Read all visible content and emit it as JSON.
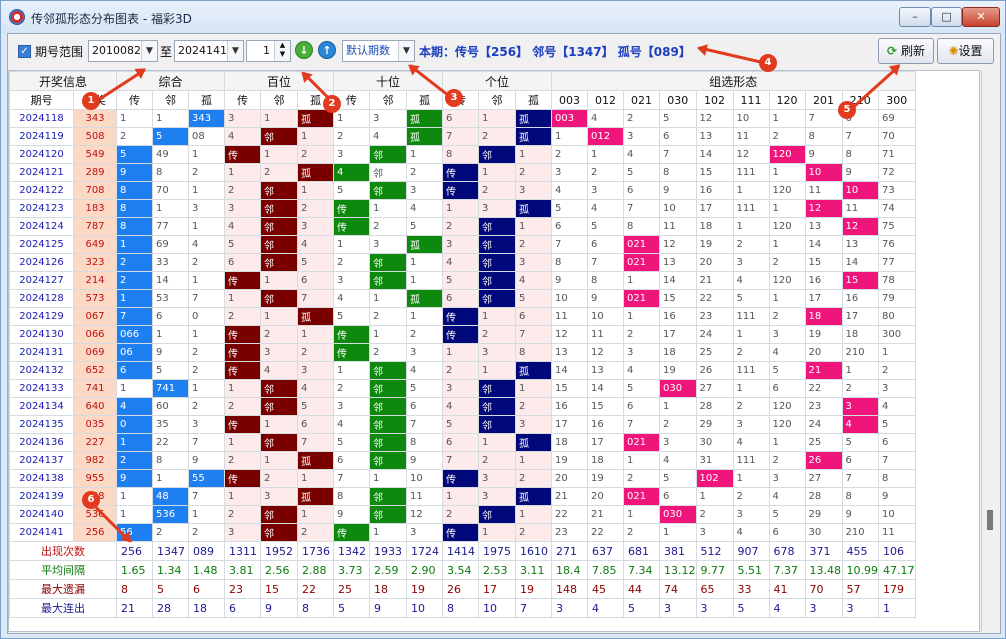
{
  "window": {
    "title": "传邻孤形态分布图表 - 福彩3D",
    "min_label": "–",
    "max_label": "□",
    "close_label": "✕"
  },
  "toolbar": {
    "range_checkbox": "✓",
    "range_label": "期号范围",
    "from_value": "2010082",
    "to_label": "至",
    "to_value": "2024141",
    "step_value": "1",
    "period_value": "默认期数",
    "current_info": "本期：传号【256】 邻号【1347】 孤号【089】",
    "refresh_label": "刷新",
    "settings_label": "设置"
  },
  "markers": [
    "1",
    "2",
    "3",
    "4",
    "5",
    "6"
  ],
  "header_groups": [
    "开奖信息",
    "综合",
    "百位",
    "十位",
    "个位",
    "组选形态"
  ],
  "col_headers": [
    "期号",
    "开奖",
    "传",
    "邻",
    "孤",
    "传",
    "邻",
    "孤",
    "传",
    "邻",
    "孤",
    "传",
    "邻",
    "孤",
    "003",
    "012",
    "021",
    "030",
    "102",
    "111",
    "120",
    "201",
    "210",
    "300"
  ],
  "rows": [
    {
      "issue": "2024118",
      "draw": "343",
      "cells": [
        "1",
        "1",
        "343",
        "3",
        "1",
        "孤",
        "1",
        "3",
        "孤",
        "6",
        "1",
        "孤",
        "003",
        "4",
        "2",
        "5",
        "12",
        "10",
        "1",
        "7",
        "6",
        "69"
      ]
    },
    {
      "issue": "2024119",
      "draw": "508",
      "cells": [
        "2",
        "5",
        "08",
        "4",
        "邻",
        "1",
        "2",
        "4",
        "孤",
        "7",
        "2",
        "孤",
        "1",
        "012",
        "3",
        "6",
        "13",
        "11",
        "2",
        "8",
        "7",
        "70"
      ]
    },
    {
      "issue": "2024120",
      "draw": "549",
      "cells": [
        "5",
        "49",
        "1",
        "传",
        "1",
        "2",
        "3",
        "邻",
        "1",
        "8",
        "邻",
        "1",
        "2",
        "1",
        "4",
        "7",
        "14",
        "12",
        "120",
        "9",
        "8",
        "71"
      ]
    },
    {
      "issue": "2024121",
      "draw": "289",
      "cells": [
        "9",
        "8",
        "2",
        "1",
        "2",
        "孤",
        "4",
        "邻",
        "2",
        "传",
        "1",
        "2",
        "3",
        "2",
        "5",
        "8",
        "15",
        "111",
        "1",
        "10",
        "9",
        "72"
      ]
    },
    {
      "issue": "2024122",
      "draw": "708",
      "cells": [
        "8",
        "70",
        "1",
        "2",
        "邻",
        "1",
        "5",
        "邻",
        "3",
        "传",
        "2",
        "3",
        "4",
        "3",
        "6",
        "9",
        "16",
        "1",
        "120",
        "11",
        "10",
        "73"
      ]
    },
    {
      "issue": "2024123",
      "draw": "183",
      "cells": [
        "8",
        "1",
        "3",
        "3",
        "邻",
        "2",
        "传",
        "1",
        "4",
        "1",
        "3",
        "孤",
        "5",
        "4",
        "7",
        "10",
        "17",
        "111",
        "1",
        "12",
        "11",
        "74"
      ]
    },
    {
      "issue": "2024124",
      "draw": "787",
      "cells": [
        "8",
        "77",
        "1",
        "4",
        "邻",
        "3",
        "传",
        "2",
        "5",
        "2",
        "邻",
        "1",
        "6",
        "5",
        "8",
        "11",
        "18",
        "1",
        "120",
        "13",
        "12",
        "75"
      ]
    },
    {
      "issue": "2024125",
      "draw": "649",
      "cells": [
        "1",
        "69",
        "4",
        "5",
        "邻",
        "4",
        "1",
        "3",
        "孤",
        "3",
        "邻",
        "2",
        "7",
        "6",
        "021",
        "12",
        "19",
        "2",
        "1",
        "14",
        "13",
        "76"
      ]
    },
    {
      "issue": "2024126",
      "draw": "323",
      "cells": [
        "2",
        "33",
        "2",
        "6",
        "邻",
        "5",
        "2",
        "邻",
        "1",
        "4",
        "邻",
        "3",
        "8",
        "7",
        "021",
        "13",
        "20",
        "3",
        "2",
        "15",
        "14",
        "77"
      ]
    },
    {
      "issue": "2024127",
      "draw": "214",
      "cells": [
        "2",
        "14",
        "1",
        "传",
        "1",
        "6",
        "3",
        "邻",
        "1",
        "5",
        "邻",
        "4",
        "9",
        "8",
        "1",
        "14",
        "21",
        "4",
        "120",
        "16",
        "15",
        "78"
      ]
    },
    {
      "issue": "2024128",
      "draw": "573",
      "cells": [
        "1",
        "53",
        "7",
        "1",
        "邻",
        "7",
        "4",
        "1",
        "孤",
        "6",
        "邻",
        "5",
        "10",
        "9",
        "021",
        "15",
        "22",
        "5",
        "1",
        "17",
        "16",
        "79"
      ]
    },
    {
      "issue": "2024129",
      "draw": "067",
      "cells": [
        "7",
        "6",
        "0",
        "2",
        "1",
        "孤",
        "5",
        "2",
        "1",
        "传",
        "1",
        "6",
        "11",
        "10",
        "1",
        "16",
        "23",
        "111",
        "2",
        "18",
        "17",
        "80"
      ]
    },
    {
      "issue": "2024130",
      "draw": "066",
      "cells": [
        "066",
        "1",
        "1",
        "传",
        "2",
        "1",
        "传",
        "1",
        "2",
        "传",
        "2",
        "7",
        "12",
        "11",
        "2",
        "17",
        "24",
        "1",
        "3",
        "19",
        "18",
        "300"
      ]
    },
    {
      "issue": "2024131",
      "draw": "069",
      "cells": [
        "06",
        "9",
        "2",
        "传",
        "3",
        "2",
        "传",
        "2",
        "3",
        "1",
        "3",
        "8",
        "13",
        "12",
        "3",
        "18",
        "25",
        "2",
        "4",
        "20",
        "210",
        "1"
      ]
    },
    {
      "issue": "2024132",
      "draw": "652",
      "cells": [
        "6",
        "5",
        "2",
        "传",
        "4",
        "3",
        "1",
        "邻",
        "4",
        "2",
        "1",
        "孤",
        "14",
        "13",
        "4",
        "19",
        "26",
        "111",
        "5",
        "21",
        "1",
        "2"
      ]
    },
    {
      "issue": "2024133",
      "draw": "741",
      "cells": [
        "1",
        "741",
        "1",
        "1",
        "邻",
        "4",
        "2",
        "邻",
        "5",
        "3",
        "邻",
        "1",
        "15",
        "14",
        "5",
        "030",
        "27",
        "1",
        "6",
        "22",
        "2",
        "3"
      ]
    },
    {
      "issue": "2024134",
      "draw": "640",
      "cells": [
        "4",
        "60",
        "2",
        "2",
        "邻",
        "5",
        "3",
        "邻",
        "6",
        "4",
        "邻",
        "2",
        "16",
        "15",
        "6",
        "1",
        "28",
        "2",
        "120",
        "23",
        "3",
        "4"
      ]
    },
    {
      "issue": "2024135",
      "draw": "035",
      "cells": [
        "0",
        "35",
        "3",
        "传",
        "1",
        "6",
        "4",
        "邻",
        "7",
        "5",
        "邻",
        "3",
        "17",
        "16",
        "7",
        "2",
        "29",
        "3",
        "120",
        "24",
        "4",
        "5"
      ]
    },
    {
      "issue": "2024136",
      "draw": "227",
      "cells": [
        "1",
        "22",
        "7",
        "1",
        "邻",
        "7",
        "5",
        "邻",
        "8",
        "6",
        "1",
        "孤",
        "18",
        "17",
        "021",
        "3",
        "30",
        "4",
        "1",
        "25",
        "5",
        "6"
      ]
    },
    {
      "issue": "2024137",
      "draw": "982",
      "cells": [
        "2",
        "8",
        "9",
        "2",
        "1",
        "孤",
        "6",
        "邻",
        "9",
        "7",
        "2",
        "1",
        "19",
        "18",
        "1",
        "4",
        "31",
        "111",
        "2",
        "26",
        "6",
        "7"
      ]
    },
    {
      "issue": "2024138",
      "draw": "955",
      "cells": [
        "9",
        "1",
        "55",
        "传",
        "2",
        "1",
        "7",
        "1",
        "10",
        "传",
        "3",
        "2",
        "20",
        "19",
        "2",
        "5",
        "102",
        "1",
        "3",
        "27",
        "7",
        "8"
      ]
    },
    {
      "issue": "2024139",
      "draw": "748",
      "cells": [
        "1",
        "48",
        "7",
        "1",
        "3",
        "孤",
        "8",
        "邻",
        "11",
        "1",
        "3",
        "孤",
        "21",
        "20",
        "021",
        "6",
        "1",
        "2",
        "4",
        "28",
        "8",
        "9"
      ]
    },
    {
      "issue": "2024140",
      "draw": "536",
      "cells": [
        "1",
        "536",
        "1",
        "2",
        "邻",
        "1",
        "9",
        "邻",
        "12",
        "2",
        "邻",
        "1",
        "22",
        "21",
        "1",
        "030",
        "2",
        "3",
        "5",
        "29",
        "9",
        "10"
      ]
    },
    {
      "issue": "2024141",
      "draw": "256",
      "cells": [
        "56",
        "2",
        "2",
        "3",
        "邻",
        "2",
        "传",
        "1",
        "3",
        "传",
        "1",
        "2",
        "23",
        "22",
        "2",
        "1",
        "3",
        "4",
        "6",
        "30",
        "210",
        "11"
      ]
    }
  ],
  "hits": [
    [
      2,
      5,
      8,
      11,
      12
    ],
    [
      1,
      4,
      8,
      11,
      13
    ],
    [
      0,
      3,
      7,
      10,
      18
    ],
    [
      0,
      5,
      6,
      9,
      19
    ],
    [
      0,
      4,
      7,
      9,
      20
    ],
    [
      0,
      4,
      6,
      11,
      19
    ],
    [
      0,
      4,
      6,
      10,
      20
    ],
    [
      0,
      4,
      8,
      10,
      14
    ],
    [
      0,
      4,
      7,
      10,
      14
    ],
    [
      0,
      3,
      7,
      10,
      20
    ],
    [
      0,
      4,
      8,
      10,
      14
    ],
    [
      0,
      5,
      9,
      19
    ],
    [
      0,
      3,
      6,
      9,
      23
    ],
    [
      0,
      3,
      6,
      22
    ],
    [
      0,
      3,
      7,
      11,
      19
    ],
    [
      1,
      4,
      7,
      10,
      15
    ],
    [
      0,
      4,
      7,
      10,
      20
    ],
    [
      0,
      3,
      7,
      10,
      20
    ],
    [
      0,
      4,
      7,
      11,
      14
    ],
    [
      0,
      5,
      7,
      19
    ],
    [
      0,
      2,
      3,
      9,
      16
    ],
    [
      1,
      5,
      7,
      11,
      14
    ],
    [
      1,
      4,
      7,
      10,
      15
    ],
    [
      0,
      4,
      6,
      9,
      22
    ]
  ],
  "summary": [
    {
      "label": "出现次数",
      "values": [
        "256",
        "1347",
        "089",
        "1311",
        "1952",
        "1736",
        "1342",
        "1933",
        "1724",
        "1414",
        "1975",
        "1610",
        "271",
        "637",
        "681",
        "381",
        "512",
        "907",
        "678",
        "371",
        "455",
        "106"
      ]
    },
    {
      "label": "平均间隔",
      "values": [
        "1.65",
        "1.34",
        "1.48",
        "3.81",
        "2.56",
        "2.88",
        "3.73",
        "2.59",
        "2.90",
        "3.54",
        "2.53",
        "3.11",
        "18.4",
        "7.85",
        "7.34",
        "13.12",
        "9.77",
        "5.51",
        "7.37",
        "13.48",
        "10.99",
        "47.17"
      ]
    },
    {
      "label": "最大遗漏",
      "values": [
        "8",
        "5",
        "6",
        "23",
        "15",
        "22",
        "25",
        "18",
        "19",
        "26",
        "17",
        "19",
        "148",
        "45",
        "44",
        "74",
        "65",
        "33",
        "41",
        "70",
        "57",
        "179"
      ]
    },
    {
      "label": "最大连出",
      "values": [
        "21",
        "28",
        "18",
        "6",
        "9",
        "8",
        "5",
        "9",
        "10",
        "8",
        "10",
        "7",
        "3",
        "4",
        "5",
        "3",
        "3",
        "5",
        "4",
        "3",
        "3",
        "1"
      ]
    }
  ],
  "colors": {
    "zh": "#1e7ff0",
    "bai": "#7a0000",
    "shi": "#0d8a0d",
    "ge": "#00087a",
    "zx": "#f0157a",
    "marker": "#e23a1e"
  }
}
